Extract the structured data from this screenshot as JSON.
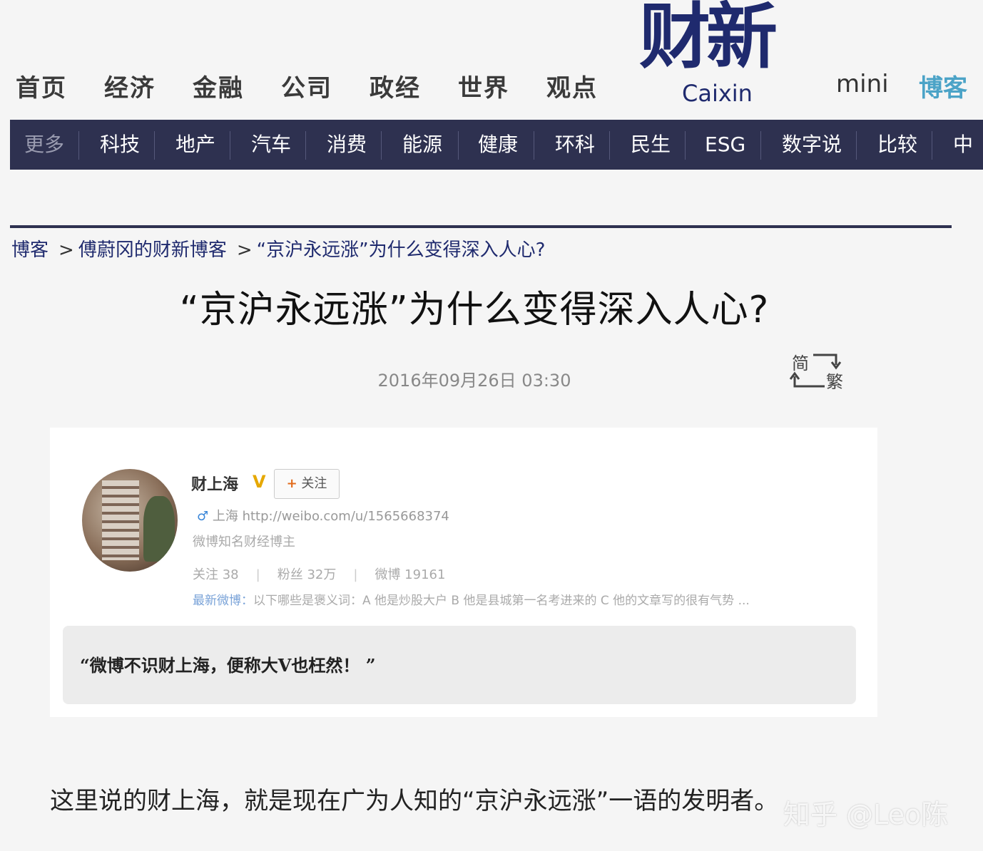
{
  "nav": {
    "items": [
      "首页",
      "经济",
      "金融",
      "公司",
      "政经",
      "世界",
      "观点"
    ],
    "logo_cn": "财新",
    "logo_en": "Caixin",
    "mini": "mini",
    "blog": "博客"
  },
  "subnav": {
    "items": [
      "更多",
      "科技",
      "地产",
      "汽车",
      "消费",
      "能源",
      "健康",
      "环科",
      "民生",
      "ESG",
      "数字说",
      "比较",
      "中国"
    ]
  },
  "breadcrumb": {
    "items": [
      "博客",
      "傅蔚冈的财新博客",
      "“京沪永远涨”为什么变得深入人心?"
    ],
    "separator": ">"
  },
  "article": {
    "title": "“京沪永远涨”为什么变得深入人心?",
    "date": "2016年09月26日 03:30",
    "convert_simplified": "简",
    "convert_traditional": "繁",
    "body": "这里说的财上海，就是现在广为人知的“京沪永远涨”一语的发明者。"
  },
  "weibo_card": {
    "name": "财上海",
    "verified": "V",
    "follow_label": "关注",
    "location_line": "上海 http://weibo.com/u/1565668374",
    "description": "微博知名财经博主",
    "stats": [
      "关注 38",
      "粉丝 32万",
      "微博 19161"
    ],
    "latest_label": "最新微博：",
    "latest_text": "以下哪些是褒义词：A 他是炒股大户 B 他是县城第一名考进来的 C 他的文章写的很有气势 ...",
    "quote": "“微博不识财上海，便称大V也枉然！ ”"
  },
  "watermark": "知乎 @Leo陈",
  "colors": {
    "nav_dark": "#2e3150",
    "logo": "#1f2a6e",
    "blog_accent": "#4ba3c7"
  }
}
